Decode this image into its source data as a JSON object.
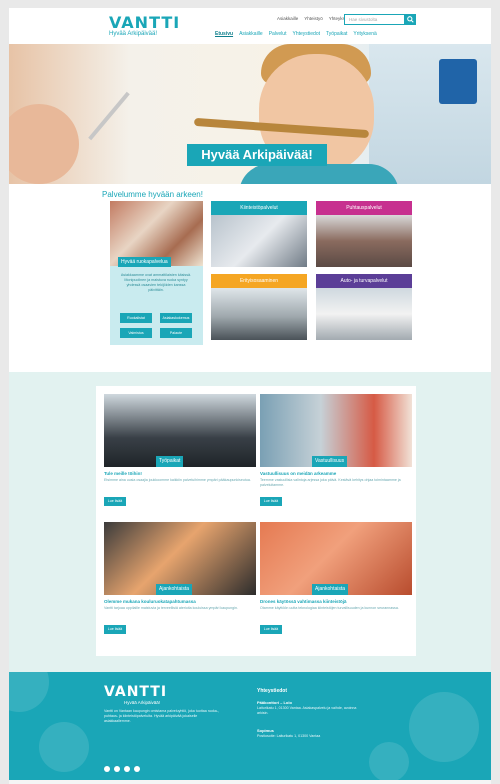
{
  "header": {
    "logo_text": "VANTTI",
    "logo_tagline": "Hyvää Arkipäivää!",
    "top_links": [
      "Asiakkaille",
      "Yhteistyö",
      "Yhteyksiä"
    ],
    "search_placeholder": "Hae sivustolta",
    "nav": [
      "Etusivu",
      "Asiakkaille",
      "Palvelut",
      "Yhteystiedot",
      "Työpaikat",
      "Yrityksenä"
    ]
  },
  "hero": {
    "banner": "Hyvää Arkipäivää!"
  },
  "services": {
    "title": "Palvelumme hyvään arkeen!",
    "featured": {
      "label": "Hyvää ruokapalvelua",
      "desc": "Asiakkaamme ovat ammattilaisten käsissä. Monipuolinen ja maistuva ruoka syntyy yhdessä osaavien tekijöiden kanssa päivittäin.",
      "buttons": [
        "Ruokalistat",
        "Asiakaskokemus",
        "Valmistus",
        "Palaute"
      ]
    },
    "tiles": [
      {
        "title": "Kiinteistöpalvelut",
        "color": "#1aa6b7"
      },
      {
        "title": "Puhtauspalvelut",
        "color": "#c7308f"
      },
      {
        "title": "Erityisosaaminen",
        "color": "#f5a623"
      },
      {
        "title": "Auto- ja turvapalvelut",
        "color": "#5b3e97"
      }
    ]
  },
  "news": [
    {
      "tag": "Työpaikat",
      "title": "Tule meille töihin!",
      "text": "Etsimme aina uusia osaajia joukkoomme kaikkiin palveluihimme ympäri pääkaupunkiseutua.",
      "button": "Lue lisää"
    },
    {
      "tag": "Vastuullisuus",
      "title": "Vastuullisuus on meidän arkeamme",
      "text": "Teemme vastuullisia valintoja arjessa joka päivä. Kestävä kehitys ohjaa toimintaamme ja palveluitamme.",
      "button": "Lue lisää"
    },
    {
      "tag": "Ajankohtaista",
      "title": "Olemme mukana kouluruokatapahtumassa",
      "text": "Vantti tarjoaa oppilaille maistuvia ja terveellisiä aterioita kouluissa ympäri kaupungin.",
      "button": "Lue lisää"
    },
    {
      "tag": "Ajankohtaista",
      "title": "Drones käytössä vahtimassa kiinteistöjä",
      "text": "Otamme käyttöön uutta teknologiaa kiinteistöjen turvallisuuden ja kunnon seurannassa.",
      "button": "Lue lisää"
    }
  ],
  "footer": {
    "logo_text": "VANTTI",
    "tagline": "Hyvää Arkipäivää!",
    "description": "Vantti on Vantaan kaupungin omistama palveluyhtiö, joka tuottaa ruoka-, puhtaus- ja kiinteistöpalveluita. Hyvää arkipäivää jokaiselle asiakkaallemme.",
    "contact_heading": "Yhteystiedot",
    "office_heading": "Pääkonttori – Lolo",
    "office_text": "Laiturikatu 1, 01300 Vantaa. Asiakaspalvelu ja vaihde, avoinna arkisin.",
    "mail_heading": "Sopimus",
    "mail_text": "Postiosoite: Laiturikatu 1, 01300 Vantaa"
  }
}
